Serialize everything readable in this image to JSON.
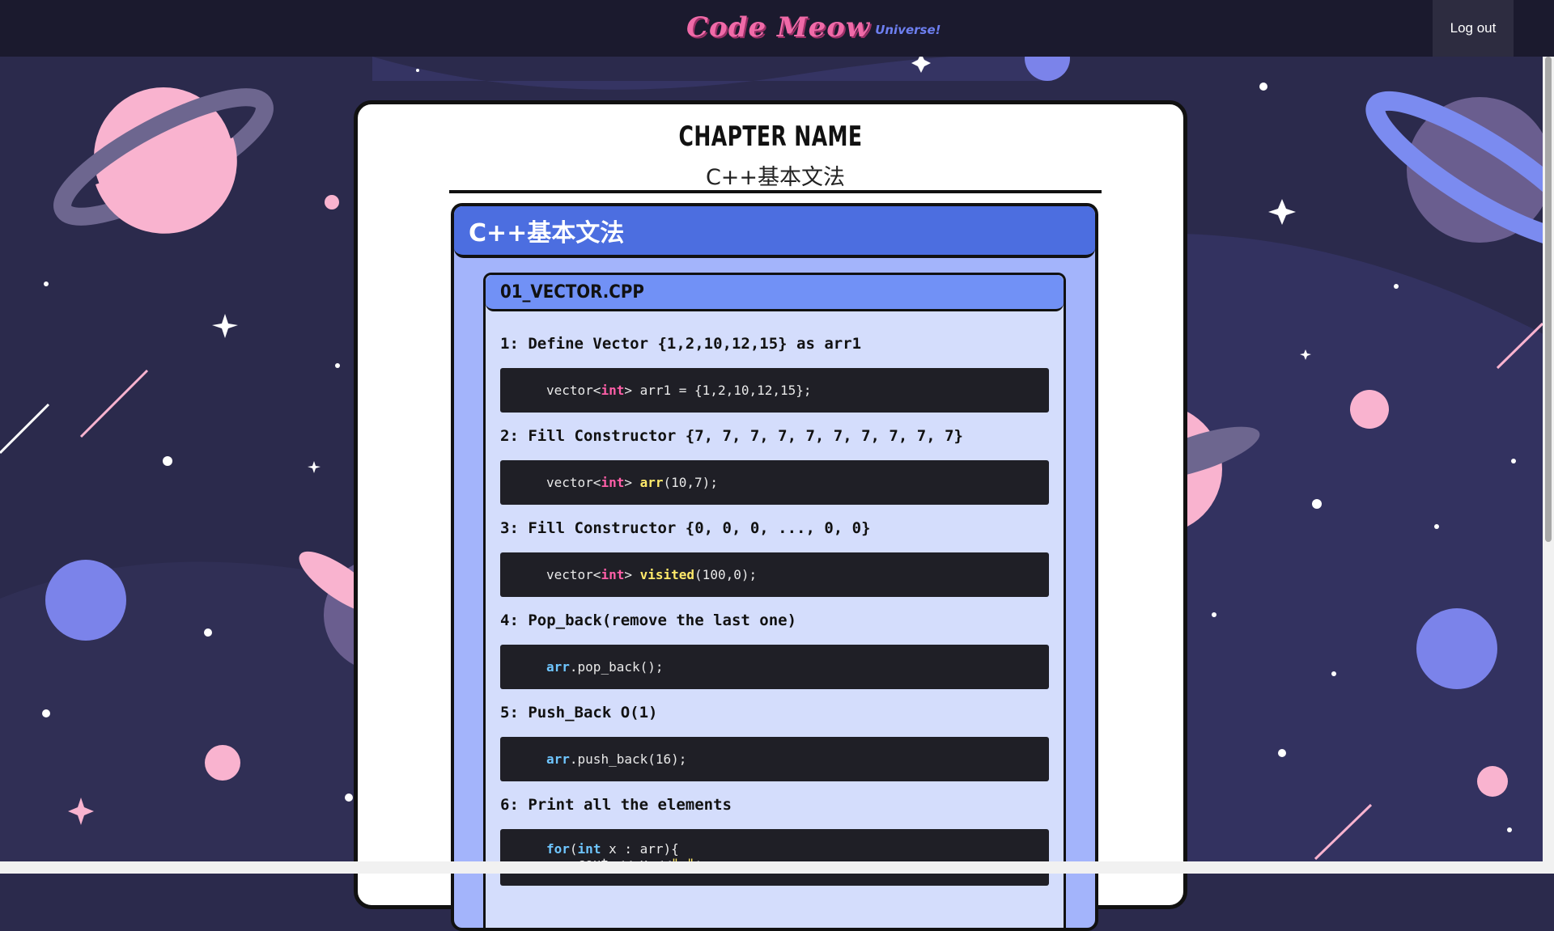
{
  "header": {
    "logo_main": "Code Meow",
    "logo_sub": "Universe!",
    "logout_label": "Log out"
  },
  "chapter": {
    "label": "CHAPTER NAME",
    "name_value": "C++基本文法"
  },
  "section": {
    "title": "C++基本文法",
    "file": {
      "name": "01_VECTOR.CPP",
      "items": [
        {
          "title": "1: Define Vector {1,2,10,12,15} as arr1",
          "code": [
            {
              "t": "vector<",
              "c": ""
            },
            {
              "t": "int",
              "c": "kw"
            },
            {
              "t": "> arr1 = {1,2,10,12,15};",
              "c": ""
            }
          ]
        },
        {
          "title": "2: Fill Constructor {7, 7, 7, 7, 7, 7, 7, 7, 7, 7}",
          "code": [
            {
              "t": "vector<",
              "c": ""
            },
            {
              "t": "int",
              "c": "kw"
            },
            {
              "t": "> ",
              "c": ""
            },
            {
              "t": "arr",
              "c": "fn"
            },
            {
              "t": "(10,7);",
              "c": ""
            }
          ]
        },
        {
          "title": "3: Fill Constructor {0, 0, 0, ..., 0, 0}",
          "code": [
            {
              "t": "vector<",
              "c": ""
            },
            {
              "t": "int",
              "c": "kw"
            },
            {
              "t": "> ",
              "c": ""
            },
            {
              "t": "visited",
              "c": "fn"
            },
            {
              "t": "(100,0);",
              "c": ""
            }
          ]
        },
        {
          "title": "4: Pop_back(remove the last one)",
          "code": [
            {
              "t": "arr",
              "c": "var"
            },
            {
              "t": ".pop_back();",
              "c": ""
            }
          ]
        },
        {
          "title": "5: Push_Back O(1)",
          "code": [
            {
              "t": "arr",
              "c": "var"
            },
            {
              "t": ".push_back(16);",
              "c": ""
            }
          ]
        },
        {
          "title": "6: Print all the elements",
          "code_lines": [
            [
              {
                "t": "for",
                "c": "var"
              },
              {
                "t": "(",
                "c": ""
              },
              {
                "t": "int",
                "c": "var"
              },
              {
                "t": " x : arr){",
                "c": ""
              }
            ],
            [
              {
                "t": "    cout << x <<",
                "c": ""
              },
              {
                "t": "\",\"",
                "c": "str"
              },
              {
                "t": ";",
                "c": ""
              }
            ]
          ]
        }
      ]
    }
  },
  "colors": {
    "background": "#2b2a4c",
    "topbar": "#1b1a2e",
    "section_header": "#4c6ee0",
    "file_header": "#7191f6",
    "code_bg": "#1f1f26",
    "keyword": "#ff5fa8",
    "function": "#ffe96a",
    "variable": "#6fc6ff"
  }
}
